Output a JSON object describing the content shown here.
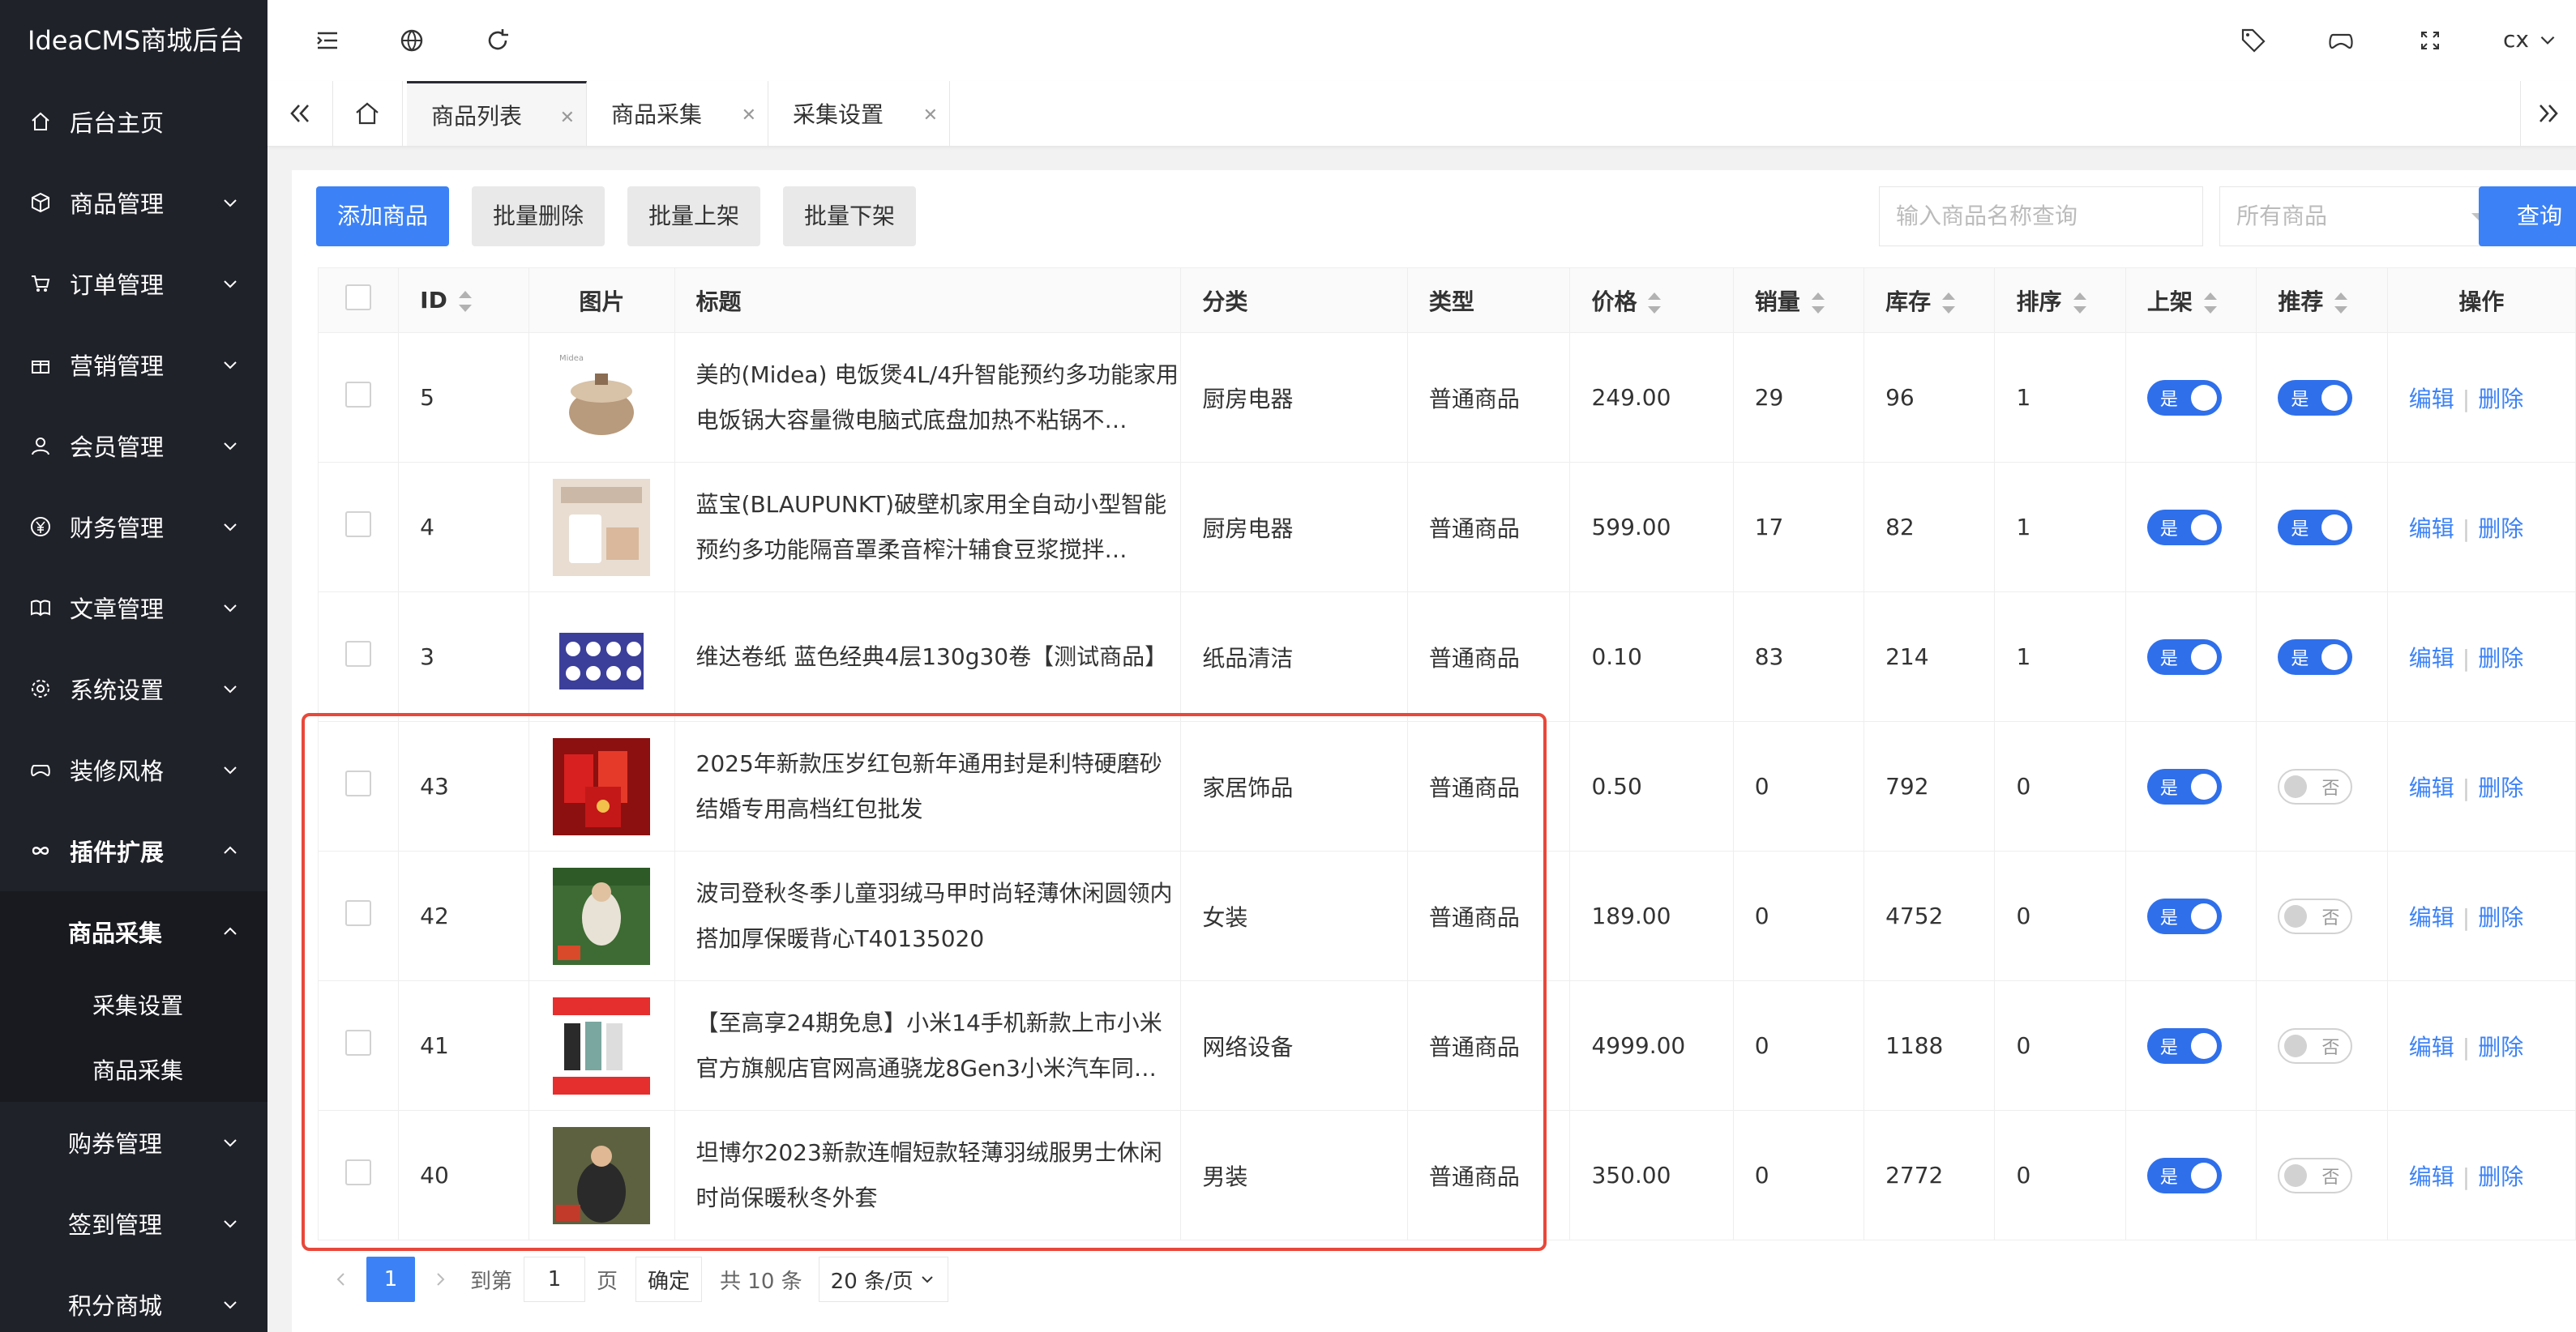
{
  "app": {
    "title": "IdeaCMS商城后台"
  },
  "sidebar": {
    "items": [
      {
        "label": "后台主页"
      },
      {
        "label": "商品管理"
      },
      {
        "label": "订单管理"
      },
      {
        "label": "营销管理"
      },
      {
        "label": "会员管理"
      },
      {
        "label": "财务管理"
      },
      {
        "label": "文章管理"
      },
      {
        "label": "系统设置"
      },
      {
        "label": "装修风格"
      },
      {
        "label": "插件扩展"
      }
    ],
    "submenu": {
      "label": "商品采集",
      "leaves": [
        "采集设置",
        "商品采集"
      ]
    },
    "after": [
      {
        "label": "购券管理"
      },
      {
        "label": "签到管理"
      },
      {
        "label": "积分商城"
      }
    ]
  },
  "header": {
    "user": "cx"
  },
  "tabs": [
    {
      "label": "商品列表"
    },
    {
      "label": "商品采集"
    },
    {
      "label": "采集设置"
    }
  ],
  "toolbar": {
    "add": "添加商品",
    "batch_delete": "批量删除",
    "batch_on": "批量上架",
    "batch_off": "批量下架",
    "search_placeholder": "输入商品名称查询",
    "filter_value": "所有商品",
    "query": "查询"
  },
  "table": {
    "headers": {
      "id": "ID",
      "image": "图片",
      "title": "标题",
      "category": "分类",
      "type": "类型",
      "price": "价格",
      "sales": "销量",
      "stock": "库存",
      "sort": "排序",
      "on_shelf": "上架",
      "recommend": "推荐",
      "ops": "操作"
    },
    "rows": [
      {
        "id": "5",
        "title": "美的(Midea) 电饭煲4L/4升智能预约多功能家用电饭锅大容量微电脑式底盘加热不粘锅不…",
        "category": "厨房电器",
        "type": "普通商品",
        "price": "249.00",
        "sales": "29",
        "stock": "96",
        "sort": "1",
        "on_shelf": "是",
        "recommend": "是"
      },
      {
        "id": "4",
        "title": "蓝宝(BLAUPUNKT)破壁机家用全自动小型智能预约多功能隔音罩柔音榨汁辅食豆浆搅拌…",
        "category": "厨房电器",
        "type": "普通商品",
        "price": "599.00",
        "sales": "17",
        "stock": "82",
        "sort": "1",
        "on_shelf": "是",
        "recommend": "是"
      },
      {
        "id": "3",
        "title": "维达卷纸 蓝色经典4层130g30卷【测试商品】",
        "category": "纸品清洁",
        "type": "普通商品",
        "price": "0.10",
        "sales": "83",
        "stock": "214",
        "sort": "1",
        "on_shelf": "是",
        "recommend": "是"
      },
      {
        "id": "43",
        "title": "2025年新款压岁红包新年通用封是利特硬磨砂结婚专用高档红包批发",
        "category": "家居饰品",
        "type": "普通商品",
        "price": "0.50",
        "sales": "0",
        "stock": "792",
        "sort": "0",
        "on_shelf": "是",
        "recommend": "否"
      },
      {
        "id": "42",
        "title": "波司登秋冬季儿童羽绒马甲时尚轻薄休闲圆领内搭加厚保暖背心T40135020",
        "category": "女装",
        "type": "普通商品",
        "price": "189.00",
        "sales": "0",
        "stock": "4752",
        "sort": "0",
        "on_shelf": "是",
        "recommend": "否"
      },
      {
        "id": "41",
        "title": "【至高享24期免息】小米14手机新款上市小米官方旗舰店官网高通骁龙8Gen3小米汽车同…",
        "category": "网络设备",
        "type": "普通商品",
        "price": "4999.00",
        "sales": "0",
        "stock": "1188",
        "sort": "0",
        "on_shelf": "是",
        "recommend": "否"
      },
      {
        "id": "40",
        "title": "坦博尔2023新款连帽短款轻薄羽绒服男士休闲时尚保暖秋冬外套",
        "category": "男装",
        "type": "普通商品",
        "price": "350.00",
        "sales": "0",
        "stock": "2772",
        "sort": "0",
        "on_shelf": "是",
        "recommend": "否"
      }
    ],
    "edit": "编辑",
    "delete": "删除"
  },
  "pager": {
    "current": "1",
    "goto": "到第",
    "page_input": "1",
    "page_unit": "页",
    "confirm": "确定",
    "total": "共 10 条",
    "page_size": "20 条/页"
  },
  "colors": {
    "primary": "#3c82f6",
    "sidebar_bg": "#20222a",
    "highlight": "#e8483a"
  }
}
